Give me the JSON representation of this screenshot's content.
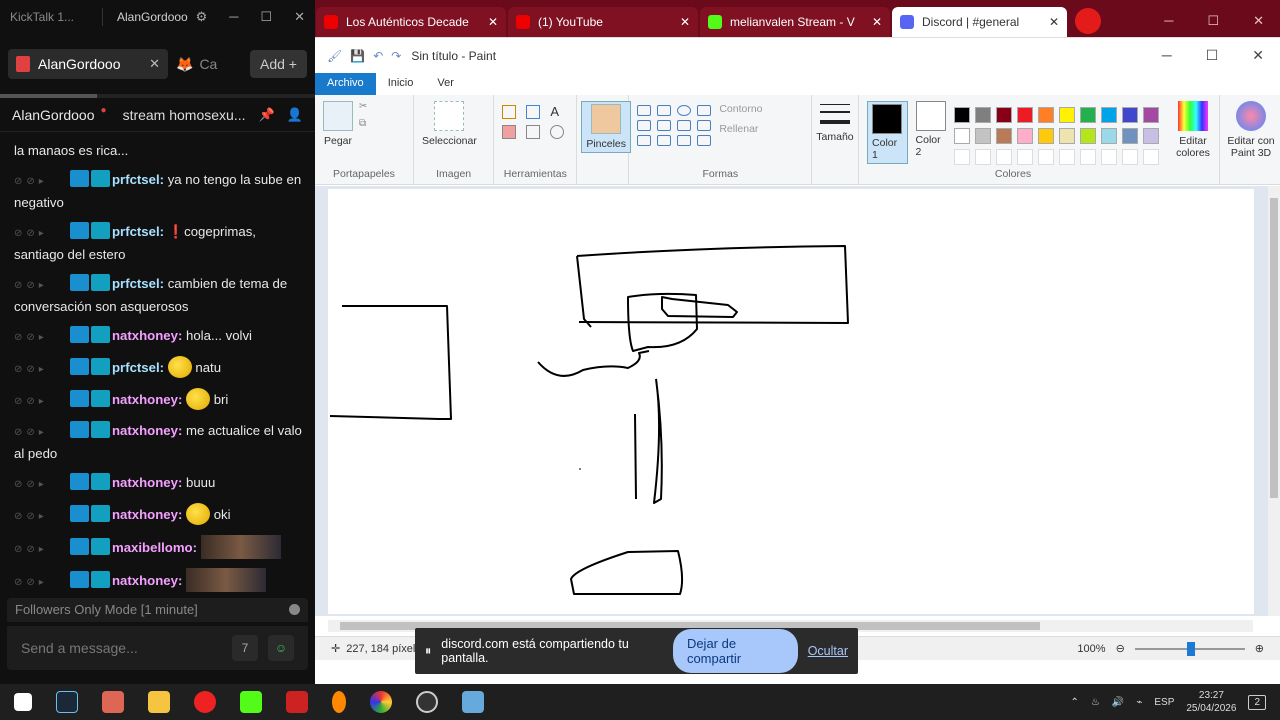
{
  "kicktalk": {
    "app_title": "KickTalk 1...",
    "window_user": "AlanGordooo",
    "tab_label": "AlanGordooo",
    "tab2_label": "Ca",
    "add_label": "Add",
    "channel_name": "AlanGordooo",
    "stream_title": "stream homosexu...",
    "first_line": "la manaos es rica...",
    "messages": [
      {
        "user": "prfctsel:",
        "text": "ya no tengo la sube en negativo",
        "color": "u1"
      },
      {
        "user": "prfctsel:",
        "text": "❗cogeprimas, santiago del estero",
        "color": "u1"
      },
      {
        "user": "prfctsel:",
        "text": "cambien de tema de conversación son asquerosos",
        "color": "u1"
      },
      {
        "user": "natxhoney:",
        "text": "hola... volvi",
        "color": "u2"
      },
      {
        "user": "prfctsel:",
        "text": "natu",
        "color": "u1",
        "emoji": true
      },
      {
        "user": "natxhoney:",
        "text": "bri",
        "color": "u2",
        "emoji": true
      },
      {
        "user": "natxhoney:",
        "text": "me actualice el valo al pedo",
        "color": "u2"
      },
      {
        "user": "natxhoney:",
        "text": "buuu",
        "color": "u2"
      },
      {
        "user": "natxhoney:",
        "text": "oki",
        "color": "u2",
        "emoji": true
      },
      {
        "user": "maxibellomo:",
        "text": "",
        "color": "u2",
        "image": true
      },
      {
        "user": "natxhoney:",
        "text": "",
        "color": "u2",
        "image": true
      }
    ],
    "followers_mode": "Followers Only Mode [1 minute]",
    "send_placeholder": "Send a message..."
  },
  "browser": {
    "tabs": [
      {
        "label": "Los Auténticos Decade",
        "fav": "fav-yt"
      },
      {
        "label": "(1) YouTube",
        "fav": "fav-yt"
      },
      {
        "label": "melianvalen Stream - V",
        "fav": "fav-kick"
      },
      {
        "label": "Discord | #general",
        "fav": "fav-dc",
        "active": true
      }
    ]
  },
  "paint": {
    "title": "Sin título - Paint",
    "menu": [
      "Archivo",
      "Inicio",
      "Ver"
    ],
    "groups": {
      "clipboard": {
        "caption": "Portapapeles",
        "paste": "Pegar"
      },
      "image": {
        "caption": "Imagen",
        "select": "Seleccionar"
      },
      "tools": {
        "caption": "Herramientas"
      },
      "brushes": {
        "label": "Pinceles"
      },
      "shapes": {
        "caption": "Formas",
        "outline": "Contorno",
        "fill": "Rellenar"
      },
      "size": {
        "label": "Tamaño"
      },
      "color1": "Color 1",
      "color2": "Color 2",
      "colors_caption": "Colores",
      "edit_colors": "Editar colores",
      "paint3d": "Editar con Paint 3D"
    },
    "palette": [
      "#000000",
      "#7f7f7f",
      "#880015",
      "#ed1c24",
      "#ff7f27",
      "#fff200",
      "#22b14c",
      "#00a2e8",
      "#3f48cc",
      "#a349a4",
      "#ffffff",
      "#c3c3c3",
      "#b97a57",
      "#ffaec9",
      "#ffc90e",
      "#efe4b0",
      "#b5e61d",
      "#99d9ea",
      "#7092be",
      "#c8bfe7"
    ],
    "status_pos": "227, 184 píxele",
    "zoom": "100%"
  },
  "share_bar": {
    "text": "discord.com está compartiendo tu pantalla.",
    "stop": "Dejar de compartir",
    "hide": "Ocultar"
  },
  "taskbar": {
    "lang": "ESP",
    "time": "23:27",
    "date": "25/04/2026",
    "notif_count": "2"
  }
}
